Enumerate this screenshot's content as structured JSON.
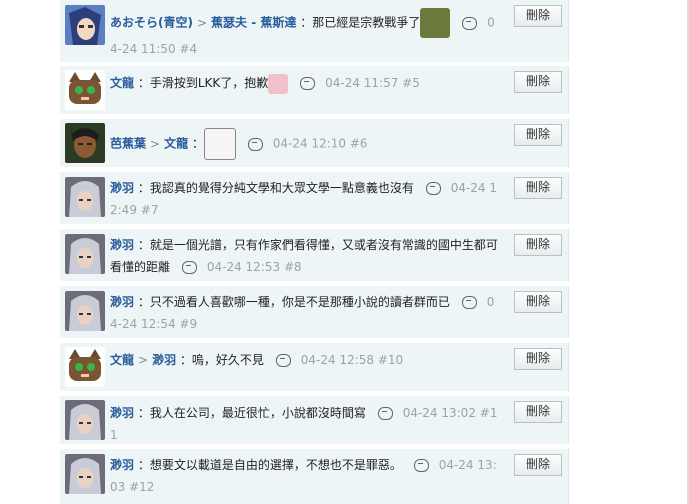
{
  "comments": [
    {
      "avatar": "avatar-blue-hair-icon",
      "user": "あおそら(青空)",
      "reply_to": "蕉瑟夫 - 蕉斯達",
      "text": "：那已經是宗教戰爭了",
      "emote": "face-emoticon",
      "timestamp": "04-24 11:50",
      "floor": "#4",
      "delete": "刪除"
    },
    {
      "avatar": "avatar-cat-icon",
      "user": "文龍",
      "reply_to": "",
      "text": "：手滑按到LKK了，抱歉",
      "emote": "sweat-emoticon",
      "timestamp": "04-24 11:57",
      "floor": "#5",
      "delete": "刪除"
    },
    {
      "avatar": "avatar-dark-hair-icon",
      "user": "芭蕉葉",
      "reply_to": "文龍",
      "text": "：",
      "emote": "hu-emoticon",
      "timestamp": "04-24 12:10",
      "floor": "#6",
      "delete": "刪除"
    },
    {
      "avatar": "avatar-silver-hair-icon",
      "user": "渺羽",
      "reply_to": "",
      "text": "：我認真的覺得分純文學和大眾文學一點意義也沒有",
      "emote": "",
      "timestamp": "04-24 12:49",
      "floor": "#7",
      "delete": "刪除"
    },
    {
      "avatar": "avatar-silver-hair-icon",
      "user": "渺羽",
      "reply_to": "",
      "text": "：就是一個光譜，只有作家們看得懂，又或者沒有常識的國中生都可看懂的距離",
      "emote": "",
      "timestamp": "04-24 12:53",
      "floor": "#8",
      "delete": "刪除"
    },
    {
      "avatar": "avatar-silver-hair-icon",
      "user": "渺羽",
      "reply_to": "",
      "text": "：只不過看人喜歡哪一種，你是不是那種小說的讀者群而已",
      "emote": "",
      "timestamp": "04-24 12:54",
      "floor": "#9",
      "delete": "刪除"
    },
    {
      "avatar": "avatar-cat-icon",
      "user": "文龍",
      "reply_to": "渺羽",
      "text": "：嗚，好久不見",
      "emote": "",
      "timestamp": "04-24 12:58",
      "floor": "#10",
      "delete": "刪除"
    },
    {
      "avatar": "avatar-silver-hair-icon",
      "user": "渺羽",
      "reply_to": "",
      "text": "：我人在公司，最近很忙，小說都沒時間寫",
      "emote": "",
      "timestamp": "04-24 13:02",
      "floor": "#11",
      "delete": "刪除"
    },
    {
      "avatar": "avatar-silver-hair-icon",
      "user": "渺羽",
      "reply_to": "",
      "text": "：想要文以載道是自由的選擇，不想也不是罪惡。",
      "emote": "",
      "timestamp": "04-24 13:03",
      "floor": "#12",
      "delete": "刪除"
    }
  ],
  "colors": {
    "row_bg": "#eef5f6",
    "username": "#2a5c9c",
    "meta": "#9aa3a8"
  }
}
